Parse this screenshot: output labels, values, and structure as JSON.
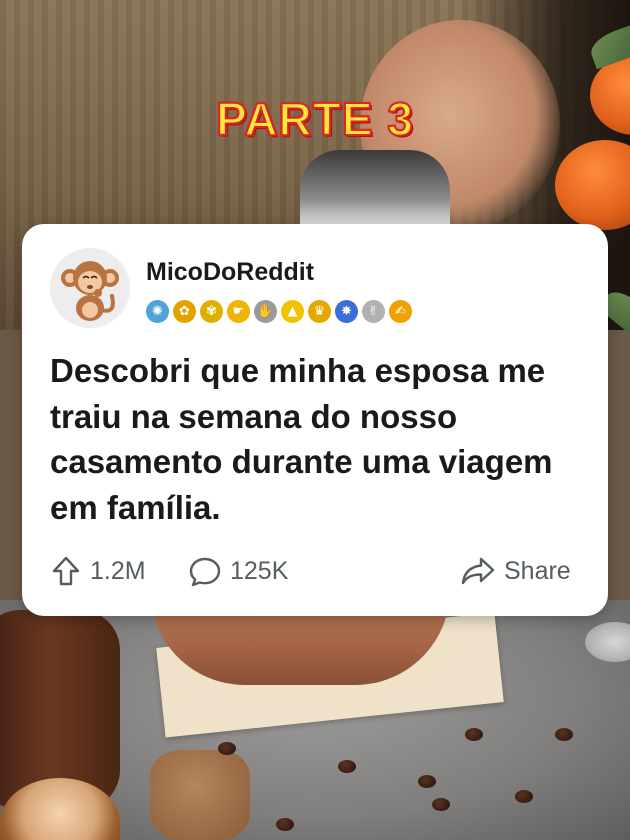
{
  "overlay": {
    "title": "PARTE 3",
    "title_fill": "#ffe63b",
    "title_stroke": "#e02121"
  },
  "post": {
    "username": "MicoDoReddit",
    "avatar_icon": "monkey-avatar-icon",
    "badges": [
      {
        "name": "sapphire-award-icon",
        "glyph": "✺",
        "color": "#4fa3d9"
      },
      {
        "name": "flower-award-icon",
        "glyph": "✿",
        "color": "#e3a200"
      },
      {
        "name": "flower-pot-award-icon",
        "glyph": "✾",
        "color": "#e0b000"
      },
      {
        "name": "hand-point-award-icon",
        "glyph": "☛",
        "color": "#f0b400"
      },
      {
        "name": "hands-award-icon",
        "glyph": "✋",
        "color": "#9a9a9a"
      },
      {
        "name": "up-arrow-award-icon",
        "glyph": "▲",
        "color": "#f2c200"
      },
      {
        "name": "trophy-award-icon",
        "glyph": "♛",
        "color": "#e4a800"
      },
      {
        "name": "starburst-award-icon",
        "glyph": "✸",
        "color": "#3b6ed8"
      },
      {
        "name": "clap-award-icon",
        "glyph": "✌",
        "color": "#b0b0b0"
      },
      {
        "name": "thumbs-up-award-icon",
        "glyph": "✍",
        "color": "#f0a000"
      }
    ],
    "text": "Descobri que minha esposa me traiu na semana do nosso casamento durante uma viagem em família.",
    "upvotes": "1.2M",
    "comments": "125K",
    "share_label": "Share",
    "text_color": "#1a1a1b",
    "meta_color": "#555d62"
  }
}
